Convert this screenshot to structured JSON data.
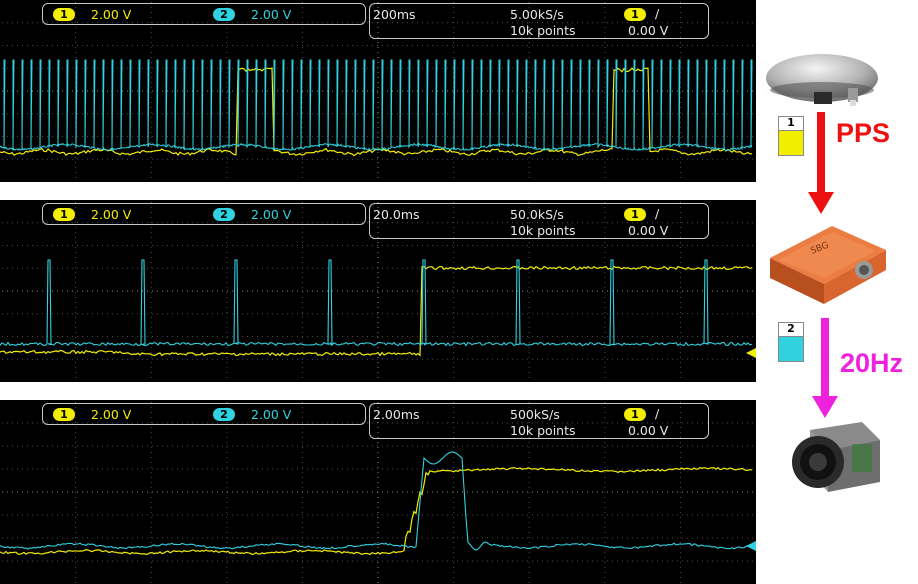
{
  "screens": [
    {
      "ch1": {
        "badge": "1",
        "volts": "2.00 V"
      },
      "ch2": {
        "badge": "2",
        "volts": "2.00 V"
      },
      "timebase": "200ms",
      "rate": "5.00kS/s",
      "points": "10k points",
      "trigger": {
        "badge": "1",
        "slope": "/",
        "level": "0.00 V"
      }
    },
    {
      "ch1": {
        "badge": "1",
        "volts": "2.00 V"
      },
      "ch2": {
        "badge": "2",
        "volts": "2.00 V"
      },
      "timebase": "20.0ms",
      "rate": "50.0kS/s",
      "points": "10k points",
      "trigger": {
        "badge": "1",
        "slope": "/",
        "level": "0.00 V"
      }
    },
    {
      "ch1": {
        "badge": "1",
        "volts": "2.00 V"
      },
      "ch2": {
        "badge": "2",
        "volts": "2.00 V"
      },
      "timebase": "2.00ms",
      "rate": "500kS/s",
      "points": "10k points",
      "trigger": {
        "badge": "1",
        "slope": "/",
        "level": "0.00 V"
      }
    }
  ],
  "diagram": {
    "pps_label": "PPS",
    "hz_label": "20Hz",
    "ch1_marker": "1",
    "ch2_marker": "2",
    "devices": [
      "gnss-antenna",
      "imu-unit",
      "camera"
    ]
  },
  "colors": {
    "ch1": "#f2ee00",
    "ch2": "#2fd2de",
    "pps_arrow": "#ee1111",
    "hz_arrow": "#ee22dd"
  }
}
